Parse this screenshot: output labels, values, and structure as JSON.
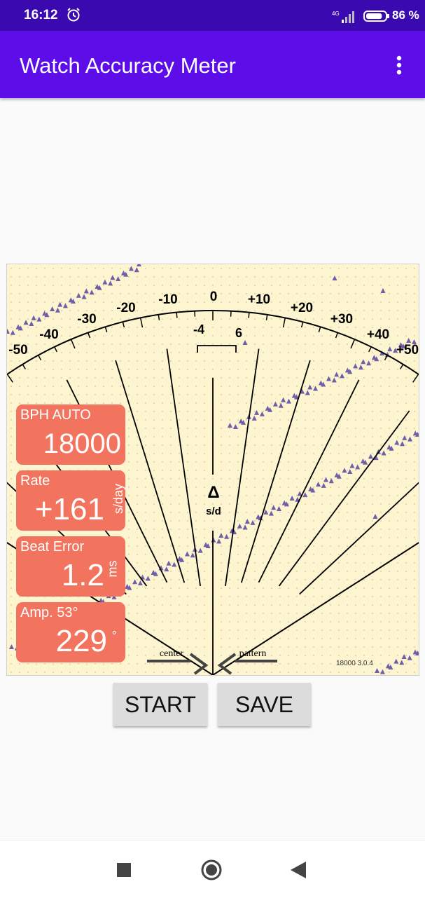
{
  "status_bar": {
    "time": "16:12",
    "network": "4G",
    "battery_percent": "86 %",
    "battery_level": 0.86
  },
  "app_bar": {
    "title": "Watch Accuracy Meter",
    "menu_icon": "more-vert-icon"
  },
  "meter": {
    "scale_labels": [
      "-50",
      "-40",
      "-30",
      "-20",
      "-10",
      "0",
      "+10",
      "+20",
      "+30",
      "+40",
      "+50"
    ],
    "inner_labels": [
      "-4",
      "6"
    ],
    "delta_symbol": "Δ",
    "delta_unit": "s/d",
    "center_label": "center",
    "pattern_label": "pattern",
    "version": "18000 3.0.4"
  },
  "readouts": {
    "bph": {
      "label": "BPH AUTO",
      "value": "18000"
    },
    "rate": {
      "label": "Rate",
      "value": "+161",
      "unit": "s/day"
    },
    "beat_error": {
      "label": "Beat Error",
      "value": "1.2",
      "unit": "ms"
    },
    "amplitude": {
      "label": "Amp. 53°",
      "value": "229",
      "unit": "°"
    }
  },
  "buttons": {
    "start": "START",
    "save": "SAVE"
  },
  "colors": {
    "status_bar": "#3a0ab0",
    "app_bar": "#5d0ee8",
    "meter_bg": "#fdf5cf",
    "panel": "#f2735e",
    "trace": "#6e5fa8"
  }
}
